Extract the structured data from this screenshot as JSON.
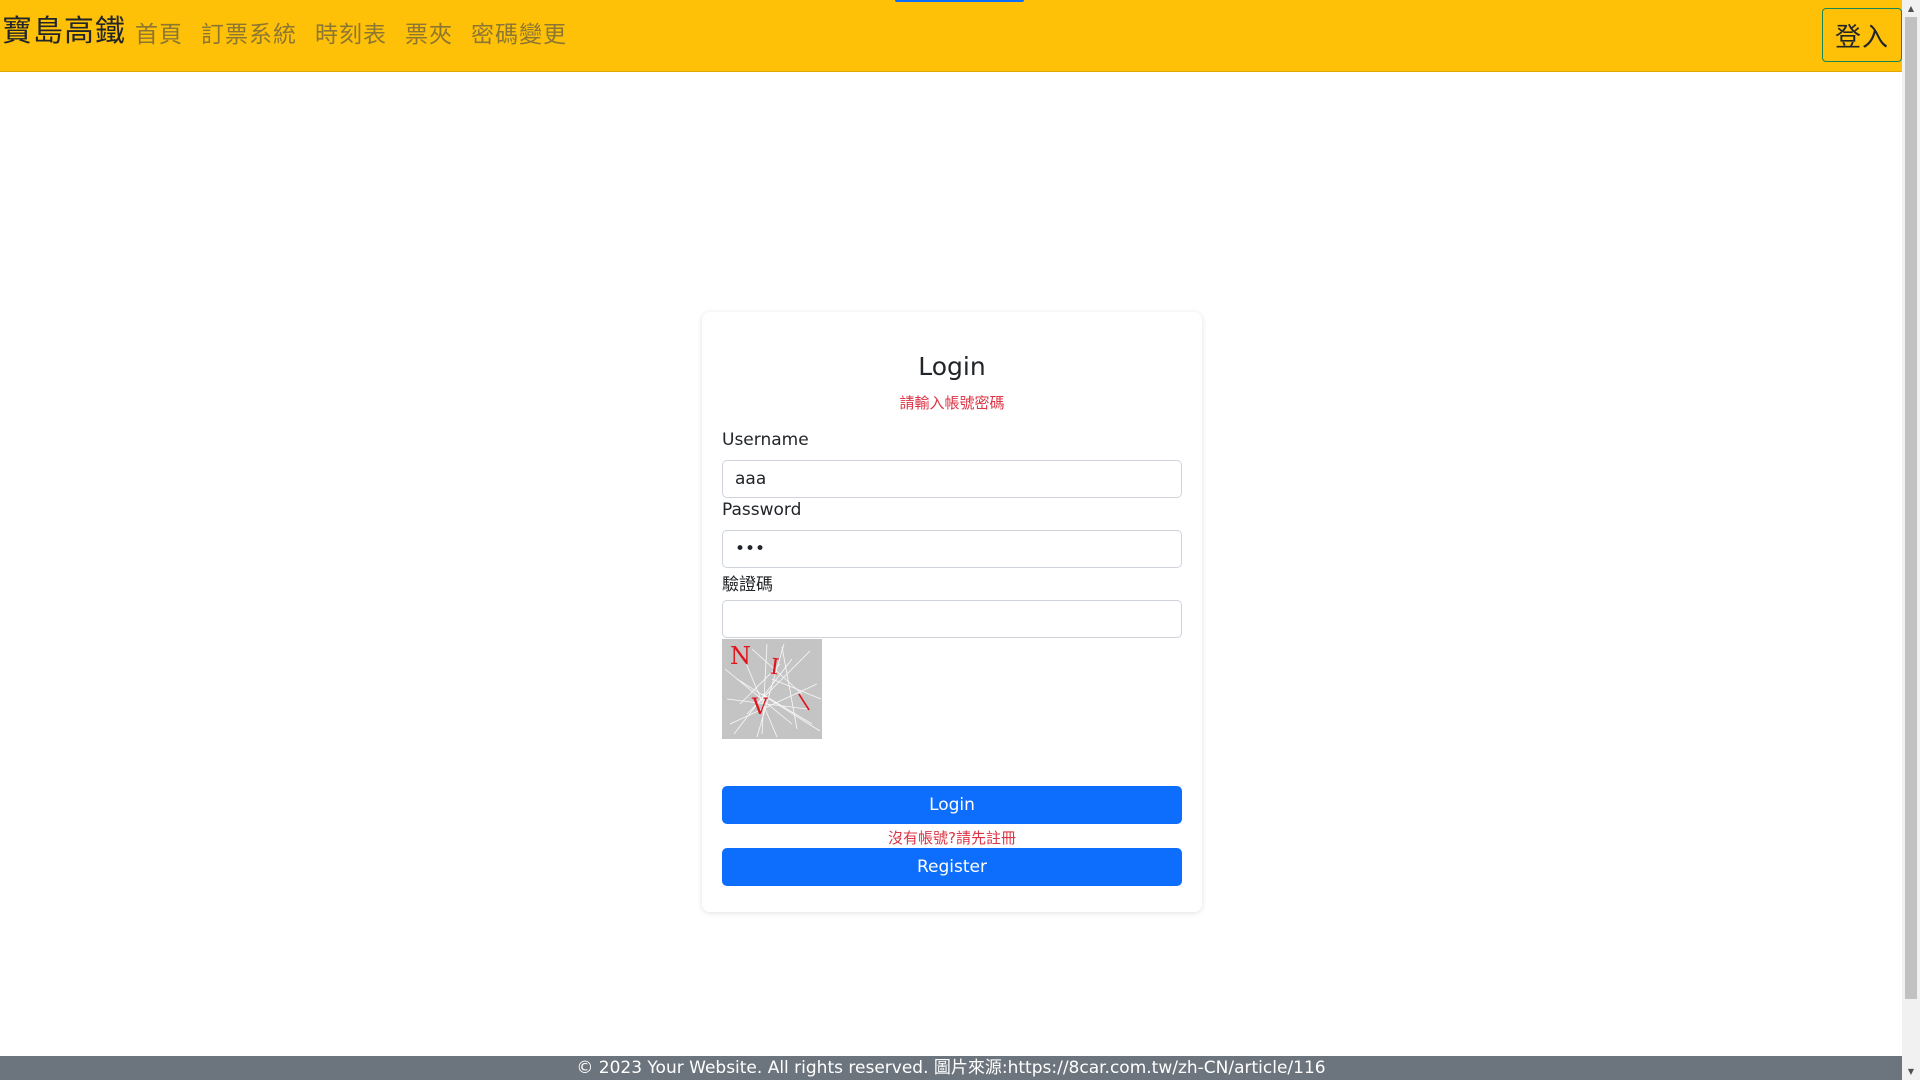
{
  "navbar": {
    "brand": "寶島高鐵",
    "links": [
      "首頁",
      "訂票系統",
      "時刻表",
      "票夾",
      "密碼變更"
    ],
    "login_button": "登入",
    "background_color": "#ffc107",
    "login_button_border_color": "#198754"
  },
  "login_card": {
    "title": "Login",
    "subtitle": "請輸入帳號密碼",
    "username": {
      "label": "Username",
      "value": "aaa"
    },
    "password": {
      "label": "Password",
      "value": "aaa"
    },
    "captcha": {
      "label": "驗證碼",
      "value": "",
      "image_text": "NI V\\"
    },
    "login_button": "Login",
    "register_hint": "沒有帳號?請先註冊",
    "register_button": "Register",
    "primary_color": "#0d6efd",
    "hint_color": "#dc3545"
  },
  "footer": {
    "text": "© 2023 Your Website. All rights reserved. 圖片來源:https://8car.com.tw/zh-CN/article/116",
    "background_color": "#6c757d"
  }
}
